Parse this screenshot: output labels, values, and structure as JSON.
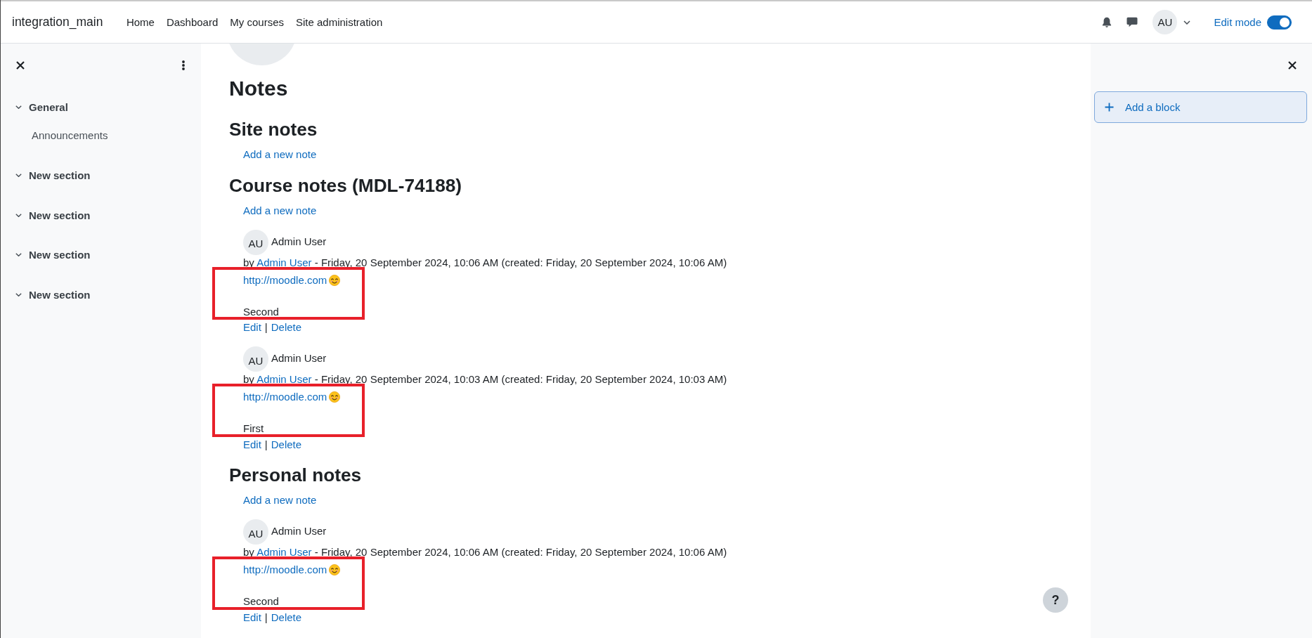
{
  "navbar": {
    "brand": "integration_main",
    "links": [
      {
        "label": "Home"
      },
      {
        "label": "Dashboard"
      },
      {
        "label": "My courses"
      },
      {
        "label": "Site administration"
      }
    ],
    "user_initials": "AU",
    "edit_mode": {
      "label": "Edit mode",
      "on": true
    }
  },
  "course_index": {
    "items": [
      {
        "title": "General",
        "expanded": true,
        "children": [
          {
            "title": "Announcements"
          }
        ]
      },
      {
        "title": "New section",
        "expanded": true
      },
      {
        "title": "New section",
        "expanded": true
      },
      {
        "title": "New section",
        "expanded": true
      },
      {
        "title": "New section",
        "expanded": true
      }
    ]
  },
  "main": {
    "title": "Notes",
    "sections": [
      {
        "title": "Site notes",
        "add_link": "Add a new note"
      },
      {
        "title": "Course notes (MDL-74188)",
        "add_link": "Add a new note",
        "notes": [
          {
            "avatar": "AU",
            "author": "Admin User",
            "by": "by",
            "by_author": "Admin User",
            "date": "- Friday, 20 September 2024, 10:06 AM (created: Friday, 20 September 2024, 10:06 AM)",
            "link": "http://moodle.com",
            "text": "Second",
            "highlighted": true,
            "actions": [
              "Edit",
              "Delete"
            ],
            "separator": "|"
          },
          {
            "avatar": "AU",
            "author": "Admin User",
            "by": "by",
            "by_author": "Admin User",
            "date": "- Friday, 20 September 2024, 10:03 AM (created: Friday, 20 September 2024, 10:03 AM)",
            "link": "http://moodle.com",
            "text": "First",
            "highlighted": true,
            "actions": [
              "Edit",
              "Delete"
            ],
            "separator": "|"
          }
        ]
      },
      {
        "title": "Personal notes",
        "add_link": "Add a new note",
        "notes": [
          {
            "avatar": "AU",
            "author": "Admin User",
            "by": "by",
            "by_author": "Admin User",
            "date": "- Friday, 20 September 2024, 10:06 AM (created: Friday, 20 September 2024, 10:06 AM)",
            "link": "http://moodle.com",
            "text": "Second",
            "highlighted": true,
            "actions": [
              "Edit",
              "Delete"
            ],
            "separator": "|"
          }
        ]
      }
    ],
    "help_button": "?"
  },
  "block_drawer": {
    "add_block": "Add a block"
  }
}
